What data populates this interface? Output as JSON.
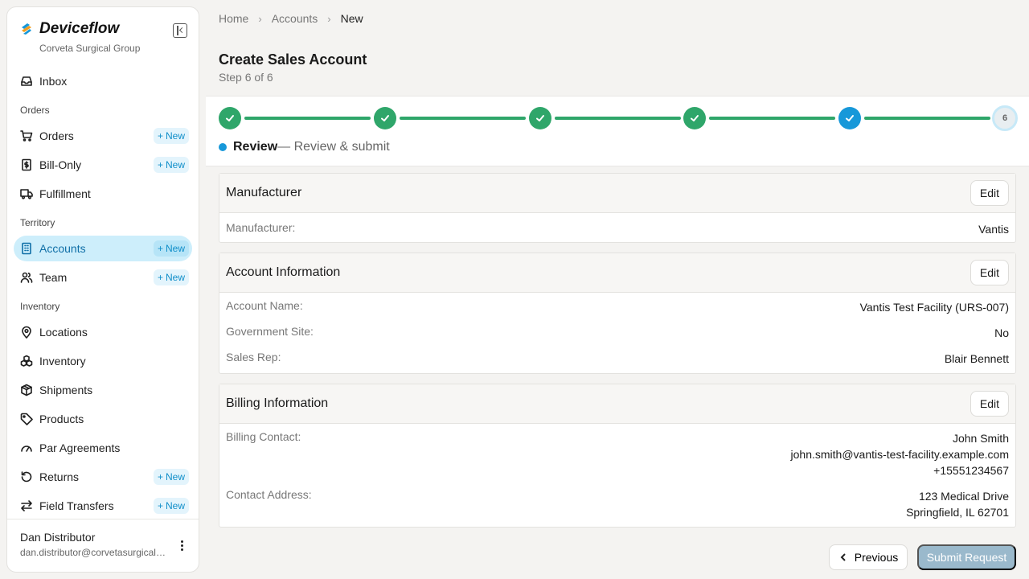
{
  "app": {
    "name": "Deviceflow",
    "org": "Corveta Surgical Group"
  },
  "sidebar": {
    "inbox": "Inbox",
    "sections": {
      "orders": "Orders",
      "territory": "Territory",
      "inventory": "Inventory"
    },
    "items": {
      "orders": {
        "label": "Orders",
        "new": "New"
      },
      "bill_only": {
        "label": "Bill-Only",
        "new": "New"
      },
      "fulfillment": {
        "label": "Fulfillment"
      },
      "accounts": {
        "label": "Accounts",
        "new": "New"
      },
      "team": {
        "label": "Team",
        "new": "New"
      },
      "locations": {
        "label": "Locations"
      },
      "inventory": {
        "label": "Inventory"
      },
      "shipments": {
        "label": "Shipments"
      },
      "products": {
        "label": "Products"
      },
      "par_agreements": {
        "label": "Par Agreements"
      },
      "returns": {
        "label": "Returns",
        "new": "New"
      },
      "field_transfers": {
        "label": "Field Transfers",
        "new": "New"
      }
    },
    "active": "accounts"
  },
  "user": {
    "name": "Dan Distributor",
    "email": "dan.distributor@corvetasurgical.com"
  },
  "breadcrumb": [
    "Home",
    "Accounts",
    "New"
  ],
  "page": {
    "title": "Create Sales Account",
    "step_text": "Step 6 of 6"
  },
  "stepper": {
    "total": 6,
    "current": 6,
    "last_label": "6",
    "current_name": "Review",
    "current_desc": "— Review & submit"
  },
  "sections": {
    "manufacturer": {
      "title": "Manufacturer",
      "edit": "Edit",
      "rows": [
        {
          "k": "Manufacturer:",
          "v": "Vantis"
        }
      ]
    },
    "account": {
      "title": "Account Information",
      "edit": "Edit",
      "rows": [
        {
          "k": "Account Name:",
          "v": "Vantis Test Facility (URS-007)"
        },
        {
          "k": "Government Site:",
          "v": "No"
        },
        {
          "k": "Sales Rep:",
          "v": "Blair Bennett"
        }
      ]
    },
    "billing": {
      "title": "Billing Information",
      "edit": "Edit",
      "contact_label": "Billing Contact:",
      "contact": [
        "John Smith",
        "john.smith@vantis-test-facility.example.com",
        "+15551234567"
      ],
      "address_label": "Contact Address:",
      "address": [
        "123 Medical Drive",
        "Springfield, IL 62701"
      ]
    }
  },
  "footer": {
    "previous": "Previous",
    "submit": "Submit Request"
  },
  "colors": {
    "accent": "#1798d9",
    "success": "#2fa66a",
    "active_bg": "#cdeefb"
  }
}
